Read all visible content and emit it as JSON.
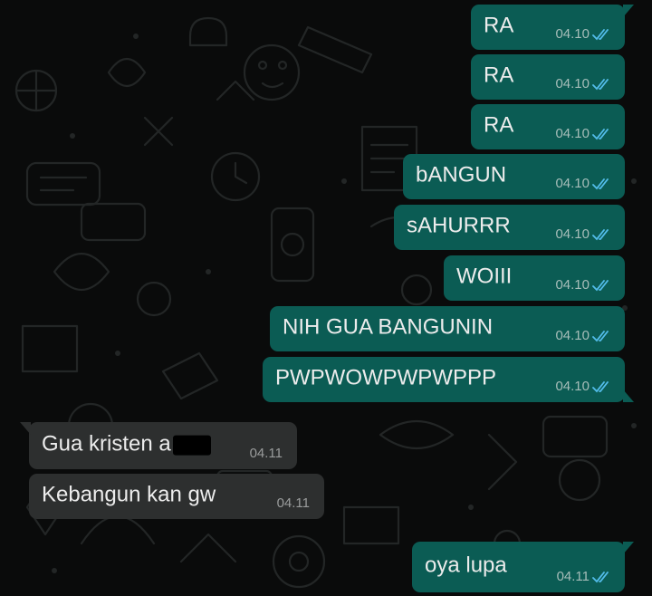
{
  "colors": {
    "background": "#0a0b0b",
    "outgoing_bubble": "#0b5c54",
    "incoming_bubble": "#2d2f2f",
    "read_ticks": "#53bdeb"
  },
  "messages": [
    {
      "direction": "out",
      "text": "RA",
      "time": "04.10",
      "status_icon": "double-tick-read-icon"
    },
    {
      "direction": "out",
      "text": "RA",
      "time": "04.10",
      "status_icon": "double-tick-read-icon"
    },
    {
      "direction": "out",
      "text": "RA",
      "time": "04.10",
      "status_icon": "double-tick-read-icon"
    },
    {
      "direction": "out",
      "text": "bANGUN",
      "time": "04.10",
      "status_icon": "double-tick-read-icon"
    },
    {
      "direction": "out",
      "text": "sAHURRR",
      "time": "04.10",
      "status_icon": "double-tick-read-icon"
    },
    {
      "direction": "out",
      "text": "WOIII",
      "time": "04.10",
      "status_icon": "double-tick-read-icon"
    },
    {
      "direction": "out",
      "text": "NIH GUA BANGUNIN",
      "time": "04.10",
      "status_icon": "double-tick-read-icon"
    },
    {
      "direction": "out",
      "text": "PWPWOWPWPWPPP",
      "time": "04.10",
      "status_icon": "double-tick-read-icon"
    },
    {
      "direction": "in",
      "text": "Gua kristen a",
      "redacted": true,
      "time": "04.11"
    },
    {
      "direction": "in",
      "text": "Kebangun kan gw",
      "time": "04.11"
    },
    {
      "direction": "out",
      "text": "oya lupa",
      "time": "04.11",
      "status_icon": "double-tick-read-icon"
    }
  ]
}
